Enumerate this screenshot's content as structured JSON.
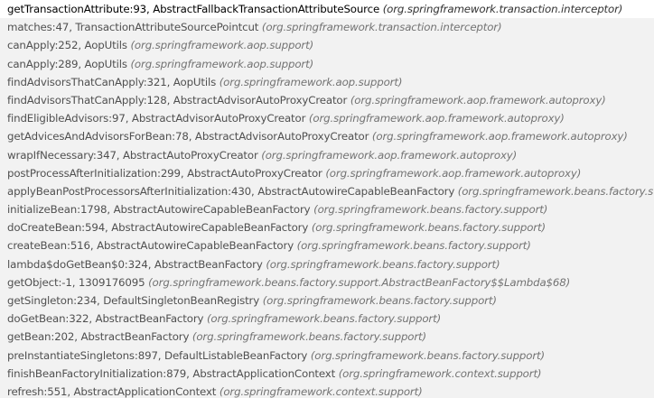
{
  "frames": [
    {
      "method": "getTransactionAttribute:93, AbstractFallbackTransactionAttributeSource",
      "package": "(org.springframework.transaction.interceptor)",
      "selected": true
    },
    {
      "method": "matches:47, TransactionAttributeSourcePointcut",
      "package": "(org.springframework.transaction.interceptor)"
    },
    {
      "method": "canApply:252, AopUtils",
      "package": "(org.springframework.aop.support)"
    },
    {
      "method": "canApply:289, AopUtils",
      "package": "(org.springframework.aop.support)"
    },
    {
      "method": "findAdvisorsThatCanApply:321, AopUtils",
      "package": "(org.springframework.aop.support)"
    },
    {
      "method": "findAdvisorsThatCanApply:128, AbstractAdvisorAutoProxyCreator",
      "package": "(org.springframework.aop.framework.autoproxy)"
    },
    {
      "method": "findEligibleAdvisors:97, AbstractAdvisorAutoProxyCreator",
      "package": "(org.springframework.aop.framework.autoproxy)"
    },
    {
      "method": "getAdvicesAndAdvisorsForBean:78, AbstractAdvisorAutoProxyCreator",
      "package": "(org.springframework.aop.framework.autoproxy)"
    },
    {
      "method": "wrapIfNecessary:347, AbstractAutoProxyCreator",
      "package": "(org.springframework.aop.framework.autoproxy)"
    },
    {
      "method": "postProcessAfterInitialization:299, AbstractAutoProxyCreator",
      "package": "(org.springframework.aop.framework.autoproxy)"
    },
    {
      "method": "applyBeanPostProcessorsAfterInitialization:430, AbstractAutowireCapableBeanFactory",
      "package": "(org.springframework.beans.factory.s"
    },
    {
      "method": "initializeBean:1798, AbstractAutowireCapableBeanFactory",
      "package": "(org.springframework.beans.factory.support)"
    },
    {
      "method": "doCreateBean:594, AbstractAutowireCapableBeanFactory",
      "package": "(org.springframework.beans.factory.support)"
    },
    {
      "method": "createBean:516, AbstractAutowireCapableBeanFactory",
      "package": "(org.springframework.beans.factory.support)"
    },
    {
      "method": "lambda$doGetBean$0:324, AbstractBeanFactory",
      "package": "(org.springframework.beans.factory.support)"
    },
    {
      "method": "getObject:-1, 1309176095",
      "package": "(org.springframework.beans.factory.support.AbstractBeanFactory$$Lambda$68)"
    },
    {
      "method": "getSingleton:234, DefaultSingletonBeanRegistry",
      "package": "(org.springframework.beans.factory.support)"
    },
    {
      "method": "doGetBean:322, AbstractBeanFactory",
      "package": "(org.springframework.beans.factory.support)"
    },
    {
      "method": "getBean:202, AbstractBeanFactory",
      "package": "(org.springframework.beans.factory.support)"
    },
    {
      "method": "preInstantiateSingletons:897, DefaultListableBeanFactory",
      "package": "(org.springframework.beans.factory.support)"
    },
    {
      "method": "finishBeanFactoryInitialization:879, AbstractApplicationContext",
      "package": "(org.springframework.context.support)"
    },
    {
      "method": "refresh:551, AbstractApplicationContext",
      "package": "(org.springframework.context.support)"
    }
  ]
}
